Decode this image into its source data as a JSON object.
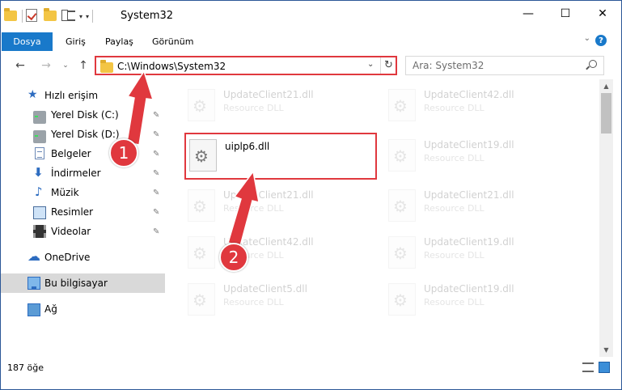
{
  "window": {
    "title": "System32",
    "minimize_glyph": "—",
    "maximize_glyph": "☐",
    "close_glyph": "✕"
  },
  "qat": {
    "dropdown_glyph": "▾",
    "customize_glyph": "▾"
  },
  "ribbon": {
    "tabs": [
      "Dosya",
      "Giriş",
      "Paylaş",
      "Görünüm"
    ],
    "expand_glyph": "⌄",
    "help_glyph": "?"
  },
  "address": {
    "path": "C:\\Windows\\System32",
    "dropdown_glyph": "⌄",
    "refresh_glyph": "↻",
    "back_glyph": "←",
    "forward_glyph": "→",
    "recent_glyph": "⌄",
    "up_glyph": "↑"
  },
  "search": {
    "placeholder": "Ara: System32"
  },
  "navpane": {
    "items": [
      {
        "label": "Hızlı erişim",
        "icon": "star-icon",
        "pinned": false
      },
      {
        "label": "Yerel Disk (C:)",
        "icon": "disk-icon",
        "pinned": true
      },
      {
        "label": "Yerel Disk (D:)",
        "icon": "disk-icon",
        "pinned": true
      },
      {
        "label": "Belgeler",
        "icon": "document-icon",
        "pinned": true
      },
      {
        "label": "İndirmeler",
        "icon": "download-icon",
        "pinned": true
      },
      {
        "label": "Müzik",
        "icon": "music-icon",
        "pinned": true
      },
      {
        "label": "Resimler",
        "icon": "pictures-icon",
        "pinned": true
      },
      {
        "label": "Videolar",
        "icon": "videos-icon",
        "pinned": true
      },
      {
        "label": "OneDrive",
        "icon": "cloud-icon",
        "pinned": false
      },
      {
        "label": "Bu bilgisayar",
        "icon": "computer-icon",
        "pinned": false
      },
      {
        "label": "Ağ",
        "icon": "network-icon",
        "pinned": false
      }
    ],
    "pin_glyph": "📌"
  },
  "files": [
    {
      "name": "UpdateClient21.dll",
      "type": "Resource DLL",
      "faded": true
    },
    {
      "name": "UpdateClient42.dll",
      "type": "Resource DLL",
      "faded": true
    },
    {
      "name": "uiplp6.dll",
      "type": "",
      "faded": false
    },
    {
      "name": "UpdateClient19.dll",
      "type": "Resource DLL",
      "faded": true
    },
    {
      "name": "UpdateClient21.dll",
      "type": "Resource DLL",
      "faded": true
    },
    {
      "name": "UpdateClient21.dll",
      "type": "Resource DLL",
      "faded": true
    },
    {
      "name": "UpdateClient42.dll",
      "type": "Resource DLL",
      "faded": true
    },
    {
      "name": "UpdateClient19.dll",
      "type": "Resource DLL",
      "faded": true
    },
    {
      "name": "UpdateClient5.dll",
      "type": "Resource DLL",
      "faded": true
    },
    {
      "name": "UpdateClient19.dll",
      "type": "Resource DLL",
      "faded": true
    }
  ],
  "scrollbar": {
    "up_glyph": "▲",
    "down_glyph": "▼"
  },
  "status": {
    "item_count": "187 öğe"
  },
  "annotations": {
    "step1": "1",
    "step2": "2",
    "color": "#e0383e"
  }
}
